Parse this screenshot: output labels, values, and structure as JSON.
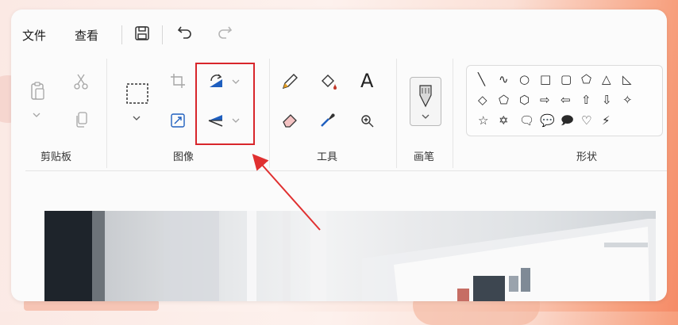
{
  "menu": {
    "file_label": "文件",
    "view_label": "查看"
  },
  "groups": {
    "clipboard": "剪贴板",
    "image": "图像",
    "tools": "工具",
    "brush": "画笔",
    "shapes": "形状"
  },
  "tools": {
    "text_glyph": "A"
  },
  "shapes": {
    "row1": [
      "╲",
      "∿",
      "○",
      "□",
      "▢",
      "⬠",
      "△",
      "◺"
    ],
    "row2": [
      "◇",
      "⬠",
      "⬡",
      "⇨",
      "⇦",
      "⇧",
      "⇩",
      "✧"
    ],
    "row3": [
      "☆",
      "✡",
      "🗨",
      "💬",
      "🗩",
      "♡",
      "⚡"
    ]
  },
  "colors": {
    "highlight_border": "#d8262b",
    "accent_blue": "#1f5fbf",
    "annotation_arrow": "#e03030"
  }
}
